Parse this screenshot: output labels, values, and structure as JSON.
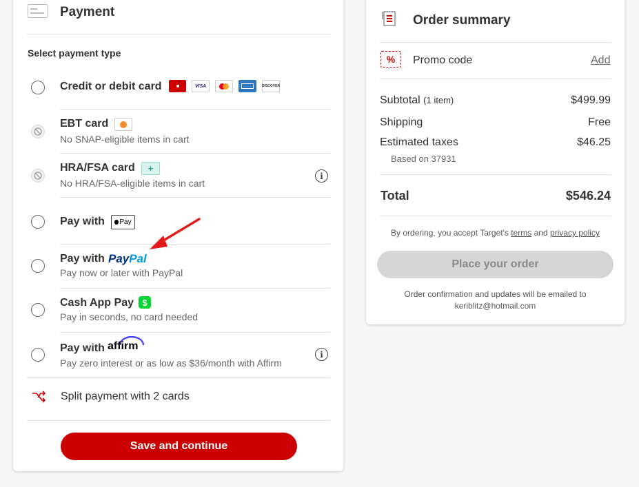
{
  "payment": {
    "title": "Payment",
    "section_label": "Select payment type",
    "options": [
      {
        "title": "Credit or debit card",
        "subtitle": ""
      },
      {
        "title": "EBT card",
        "subtitle": "No SNAP-eligible items in cart"
      },
      {
        "title": "HRA/FSA card",
        "subtitle": "No HRA/FSA-eligible items in cart"
      },
      {
        "title": "Pay with",
        "subtitle": ""
      },
      {
        "title": "Pay with",
        "subtitle": "Pay now or later with PayPal"
      },
      {
        "title": "Cash App Pay",
        "subtitle": "Pay in seconds, no card needed"
      },
      {
        "title": "Pay with",
        "subtitle": "Pay zero interest or as low as $36/month with Affirm"
      }
    ],
    "card_brands": [
      "VISA",
      "DISCOVER"
    ],
    "applepay_label": "Pay",
    "paypal_label_pay": "Pay",
    "paypal_label_pal": "Pal",
    "cashapp_symbol": "$",
    "affirm_label": "affirm",
    "split_payment": "Split payment with 2 cards",
    "save_button": "Save and continue"
  },
  "summary": {
    "title": "Order summary",
    "promo_label": "Promo code",
    "promo_action": "Add",
    "subtotal_label": "Subtotal",
    "subtotal_count": "(1 item)",
    "subtotal_value": "$499.99",
    "shipping_label": "Shipping",
    "shipping_value": "Free",
    "taxes_label": "Estimated taxes",
    "taxes_value": "$46.25",
    "taxes_note": "Based on 37931",
    "total_label": "Total",
    "total_value": "$546.24",
    "terms_prefix": "By ordering, you accept Target's",
    "terms_link": "terms",
    "terms_and": "and",
    "privacy_link": "privacy policy",
    "place_order": "Place your order",
    "confirm_line1": "Order confirmation and updates will be emailed to",
    "confirm_email": "keriblitz@hotmail.com"
  },
  "colors": {
    "brand_red": "#cc0000",
    "paypal_dark": "#003087",
    "paypal_light": "#009cde",
    "cashapp_green": "#00d632",
    "affirm_blue": "#4a4af4"
  }
}
